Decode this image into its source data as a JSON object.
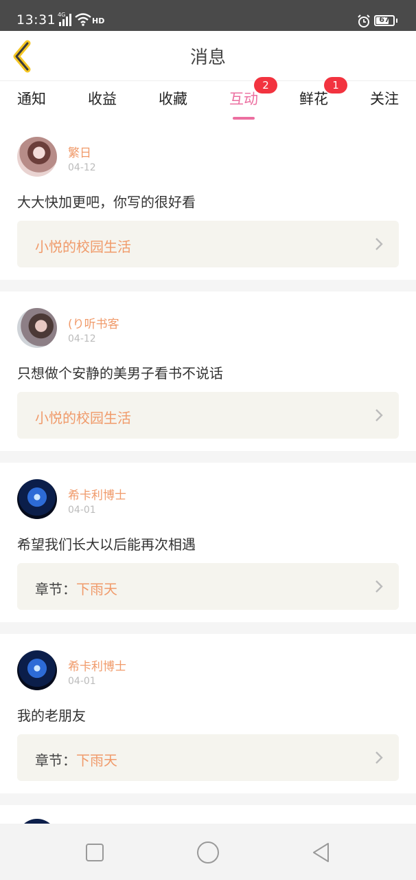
{
  "status_bar": {
    "time": "13:31",
    "network": "4G",
    "hd": "HD",
    "battery": "67"
  },
  "header": {
    "title": "消息",
    "back_icon": "chevron-left-icon"
  },
  "tabs": [
    {
      "label": "通知",
      "active": false,
      "badge": null
    },
    {
      "label": "收益",
      "active": false,
      "badge": null
    },
    {
      "label": "收藏",
      "active": false,
      "badge": null
    },
    {
      "label": "互动",
      "active": true,
      "badge": "2"
    },
    {
      "label": "鲜花",
      "active": false,
      "badge": "1"
    },
    {
      "label": "关注",
      "active": false,
      "badge": null
    }
  ],
  "messages": [
    {
      "username": "繁日",
      "date": "04-12",
      "comment": "大大快加更吧，你写的很好看",
      "link_prefix": "",
      "link_text": "小悦的校园生活"
    },
    {
      "username": "(り听书客",
      "date": "04-12",
      "comment": "只想做个安静的美男子看书不说话",
      "link_prefix": "",
      "link_text": "小悦的校园生活"
    },
    {
      "username": "希卡利博士",
      "date": "04-01",
      "comment": "希望我们长大以后能再次相遇",
      "link_prefix": "章节：",
      "link_text": "下雨天"
    },
    {
      "username": "希卡利博士",
      "date": "04-01",
      "comment": "我的老朋友",
      "link_prefix": "章节：",
      "link_text": "下雨天"
    }
  ],
  "colors": {
    "accent_pink": "#ec6fa0",
    "accent_orange": "#f09a6a",
    "badge_red": "#f2333f",
    "back_yellow": "#f5c623"
  },
  "nav_bar": {
    "icons": [
      "square-icon",
      "circle-icon",
      "triangle-back-icon"
    ]
  }
}
